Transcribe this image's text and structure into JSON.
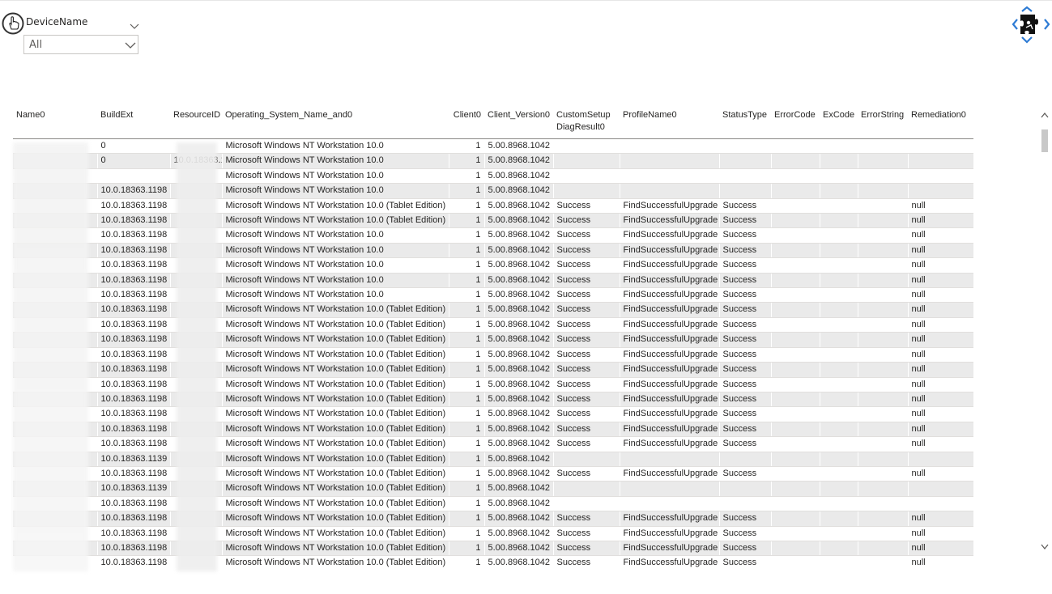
{
  "slicer": {
    "title": "DeviceName",
    "selected": "All",
    "icons": {
      "left": "hand-pointer-icon",
      "title_chevron": "chevron-down-icon",
      "dropdown_chevron": "chevron-down-icon"
    }
  },
  "logo": {
    "icon": "puzzle-logo-icon"
  },
  "table": {
    "columns": [
      "Name0",
      "BuildExt",
      "ResourceID",
      "Operating_System_Name_and0",
      "Client0",
      "Client_Version0",
      "CustomSetup DiagResult0",
      "ProfileName0",
      "StatusType",
      "ErrorCode",
      "ExCode",
      "ErrorString",
      "Remediation0"
    ],
    "rows": [
      [
        "",
        "0",
        "",
        "Microsoft Windows NT Workstation 10.0",
        "1",
        "5.00.8968.1042",
        "",
        "",
        "",
        "",
        "",
        "",
        ""
      ],
      [
        "",
        "0",
        "10.0.18363.1198",
        "Microsoft Windows NT Workstation 10.0",
        "1",
        "5.00.8968.1042",
        "",
        "",
        "",
        "",
        "",
        "",
        ""
      ],
      [
        "",
        "",
        "",
        "Microsoft Windows NT Workstation 10.0",
        "1",
        "5.00.8968.1042",
        "",
        "",
        "",
        "",
        "",
        "",
        ""
      ],
      [
        "",
        "10.0.18363.1198",
        "",
        "Microsoft Windows NT Workstation 10.0",
        "1",
        "5.00.8968.1042",
        "",
        "",
        "",
        "",
        "",
        "",
        ""
      ],
      [
        "",
        "10.0.18363.1198",
        "",
        "Microsoft Windows NT Workstation 10.0 (Tablet Edition)",
        "1",
        "5.00.8968.1042",
        "Success",
        "FindSuccessfulUpgrade",
        "Success",
        "",
        "",
        "",
        "null"
      ],
      [
        "",
        "10.0.18363.1198",
        "",
        "Microsoft Windows NT Workstation 10.0 (Tablet Edition)",
        "1",
        "5.00.8968.1042",
        "Success",
        "FindSuccessfulUpgrade",
        "Success",
        "",
        "",
        "",
        "null"
      ],
      [
        "",
        "10.0.18363.1198",
        "",
        "Microsoft Windows NT Workstation 10.0",
        "1",
        "5.00.8968.1042",
        "Success",
        "FindSuccessfulUpgrade",
        "Success",
        "",
        "",
        "",
        "null"
      ],
      [
        "",
        "10.0.18363.1198",
        "",
        "Microsoft Windows NT Workstation 10.0",
        "1",
        "5.00.8968.1042",
        "Success",
        "FindSuccessfulUpgrade",
        "Success",
        "",
        "",
        "",
        "null"
      ],
      [
        "",
        "10.0.18363.1198",
        "",
        "Microsoft Windows NT Workstation 10.0",
        "1",
        "5.00.8968.1042",
        "Success",
        "FindSuccessfulUpgrade",
        "Success",
        "",
        "",
        "",
        "null"
      ],
      [
        "",
        "10.0.18363.1198",
        "",
        "Microsoft Windows NT Workstation 10.0",
        "1",
        "5.00.8968.1042",
        "Success",
        "FindSuccessfulUpgrade",
        "Success",
        "",
        "",
        "",
        "null"
      ],
      [
        "",
        "10.0.18363.1198",
        "",
        "Microsoft Windows NT Workstation 10.0",
        "1",
        "5.00.8968.1042",
        "Success",
        "FindSuccessfulUpgrade",
        "Success",
        "",
        "",
        "",
        "null"
      ],
      [
        "",
        "10.0.18363.1198",
        "",
        "Microsoft Windows NT Workstation 10.0 (Tablet Edition)",
        "1",
        "5.00.8968.1042",
        "Success",
        "FindSuccessfulUpgrade",
        "Success",
        "",
        "",
        "",
        "null"
      ],
      [
        "",
        "10.0.18363.1198",
        "",
        "Microsoft Windows NT Workstation 10.0 (Tablet Edition)",
        "1",
        "5.00.8968.1042",
        "Success",
        "FindSuccessfulUpgrade",
        "Success",
        "",
        "",
        "",
        "null"
      ],
      [
        "",
        "10.0.18363.1198",
        "",
        "Microsoft Windows NT Workstation 10.0 (Tablet Edition)",
        "1",
        "5.00.8968.1042",
        "Success",
        "FindSuccessfulUpgrade",
        "Success",
        "",
        "",
        "",
        "null"
      ],
      [
        "",
        "10.0.18363.1198",
        "",
        "Microsoft Windows NT Workstation 10.0 (Tablet Edition)",
        "1",
        "5.00.8968.1042",
        "Success",
        "FindSuccessfulUpgrade",
        "Success",
        "",
        "",
        "",
        "null"
      ],
      [
        "",
        "10.0.18363.1198",
        "",
        "Microsoft Windows NT Workstation 10.0 (Tablet Edition)",
        "1",
        "5.00.8968.1042",
        "Success",
        "FindSuccessfulUpgrade",
        "Success",
        "",
        "",
        "",
        "null"
      ],
      [
        "",
        "10.0.18363.1198",
        "",
        "Microsoft Windows NT Workstation 10.0 (Tablet Edition)",
        "1",
        "5.00.8968.1042",
        "Success",
        "FindSuccessfulUpgrade",
        "Success",
        "",
        "",
        "",
        "null"
      ],
      [
        "",
        "10.0.18363.1198",
        "",
        "Microsoft Windows NT Workstation 10.0 (Tablet Edition)",
        "1",
        "5.00.8968.1042",
        "Success",
        "FindSuccessfulUpgrade",
        "Success",
        "",
        "",
        "",
        "null"
      ],
      [
        "",
        "10.0.18363.1198",
        "",
        "Microsoft Windows NT Workstation 10.0 (Tablet Edition)",
        "1",
        "5.00.8968.1042",
        "Success",
        "FindSuccessfulUpgrade",
        "Success",
        "",
        "",
        "",
        "null"
      ],
      [
        "",
        "10.0.18363.1198",
        "",
        "Microsoft Windows NT Workstation 10.0 (Tablet Edition)",
        "1",
        "5.00.8968.1042",
        "Success",
        "FindSuccessfulUpgrade",
        "Success",
        "",
        "",
        "",
        "null"
      ],
      [
        "",
        "10.0.18363.1198",
        "",
        "Microsoft Windows NT Workstation 10.0 (Tablet Edition)",
        "1",
        "5.00.8968.1042",
        "Success",
        "FindSuccessfulUpgrade",
        "Success",
        "",
        "",
        "",
        "null"
      ],
      [
        "",
        "10.0.18363.1139",
        "",
        "Microsoft Windows NT Workstation 10.0 (Tablet Edition)",
        "1",
        "5.00.8968.1042",
        "",
        "",
        "",
        "",
        "",
        "",
        ""
      ],
      [
        "",
        "10.0.18363.1198",
        "",
        "Microsoft Windows NT Workstation 10.0 (Tablet Edition)",
        "1",
        "5.00.8968.1042",
        "Success",
        "FindSuccessfulUpgrade",
        "Success",
        "",
        "",
        "",
        "null"
      ],
      [
        "",
        "10.0.18363.1139",
        "",
        "Microsoft Windows NT Workstation 10.0 (Tablet Edition)",
        "1",
        "5.00.8968.1042",
        "",
        "",
        "",
        "",
        "",
        "",
        ""
      ],
      [
        "",
        "10.0.18363.1198",
        "",
        "Microsoft Windows NT Workstation 10.0 (Tablet Edition)",
        "1",
        "5.00.8968.1042",
        "",
        "",
        "",
        "",
        "",
        "",
        ""
      ],
      [
        "",
        "10.0.18363.1198",
        "",
        "Microsoft Windows NT Workstation 10.0 (Tablet Edition)",
        "1",
        "5.00.8968.1042",
        "Success",
        "FindSuccessfulUpgrade",
        "Success",
        "",
        "",
        "",
        "null"
      ],
      [
        "",
        "10.0.18363.1198",
        "",
        "Microsoft Windows NT Workstation 10.0 (Tablet Edition)",
        "1",
        "5.00.8968.1042",
        "Success",
        "FindSuccessfulUpgrade",
        "Success",
        "",
        "",
        "",
        "null"
      ],
      [
        "",
        "10.0.18363.1198",
        "",
        "Microsoft Windows NT Workstation 10.0 (Tablet Edition)",
        "1",
        "5.00.8968.1042",
        "Success",
        "FindSuccessfulUpgrade",
        "Success",
        "",
        "",
        "",
        "null"
      ],
      [
        "",
        "10.0.18363.1198",
        "",
        "Microsoft Windows NT Workstation 10.0 (Tablet Edition)",
        "1",
        "5.00.8968.1042",
        "Success",
        "FindSuccessfulUpgrade",
        "Success",
        "",
        "",
        "",
        "null"
      ]
    ]
  },
  "scrollbar": {
    "icons": {
      "up": "chevron-up-icon",
      "down": "chevron-down-icon"
    }
  },
  "colors": {
    "row_alt": "#eaeaea",
    "text": "#252423",
    "logo_blue": "#2e7bd4"
  }
}
